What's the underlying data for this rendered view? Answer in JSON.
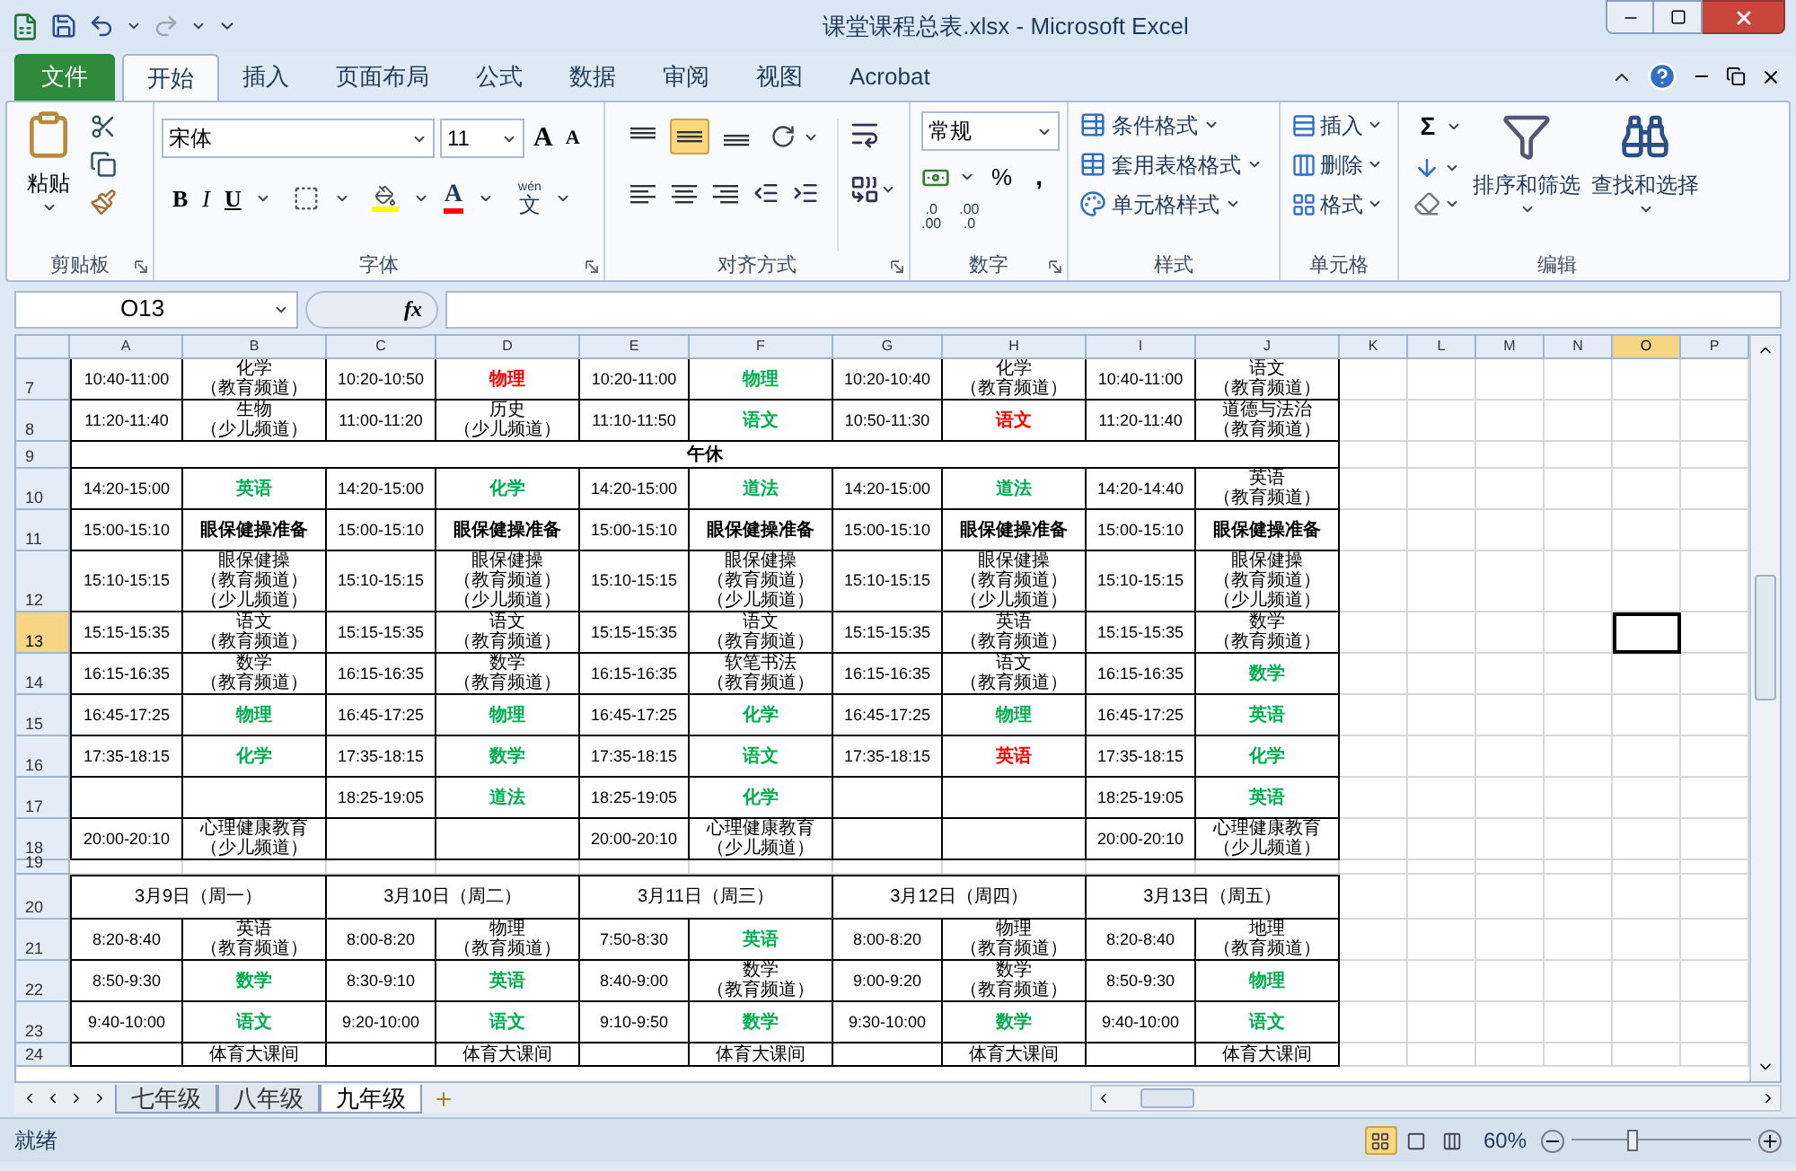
{
  "window": {
    "title": "课堂课程总表.xlsx - Microsoft Excel"
  },
  "ribbon_tabs": [
    {
      "label": "文件",
      "kind": "file",
      "selected": false
    },
    {
      "label": "开始",
      "kind": "tab",
      "selected": true
    },
    {
      "label": "插入",
      "kind": "tab",
      "selected": false
    },
    {
      "label": "页面布局",
      "kind": "tab",
      "selected": false
    },
    {
      "label": "公式",
      "kind": "tab",
      "selected": false
    },
    {
      "label": "数据",
      "kind": "tab",
      "selected": false
    },
    {
      "label": "审阅",
      "kind": "tab",
      "selected": false
    },
    {
      "label": "视图",
      "kind": "tab",
      "selected": false
    },
    {
      "label": "Acrobat",
      "kind": "tab",
      "selected": false
    }
  ],
  "clipboard": {
    "paste": "粘贴",
    "label": "剪贴板"
  },
  "font": {
    "label": "字体",
    "family": "宋体",
    "size": "11",
    "grow": "A",
    "shrink": "A",
    "bold": "B",
    "italic": "I",
    "underline": "U",
    "font_color": "A",
    "phonetic_top": "wén",
    "phonetic_bottom": "文"
  },
  "alignment": {
    "label": "对齐方式",
    "vertical_align": [
      {
        "selected": false
      },
      {
        "selected": true
      },
      {
        "selected": false
      }
    ]
  },
  "number": {
    "label": "数字",
    "format": "常规",
    "percent": "%",
    "comma": ",",
    "increase_decimal": [
      ".0",
      ".00"
    ],
    "decrease_decimal": [
      ".00",
      ".0"
    ]
  },
  "styles": {
    "label": "样式",
    "items": [
      "条件格式",
      "套用表格格式",
      "单元格样式"
    ]
  },
  "cells": {
    "label": "单元格",
    "items": [
      "插入",
      "删除",
      "格式"
    ]
  },
  "editing": {
    "label": "编辑",
    "sum": "Σ",
    "sort": "排序和筛选",
    "find": "查找和选择"
  },
  "formula_bar": {
    "name_box": "O13",
    "fx": "fx"
  },
  "columns": [
    {
      "label": "A",
      "selected": false
    },
    {
      "label": "B",
      "selected": false
    },
    {
      "label": "C",
      "selected": false
    },
    {
      "label": "D",
      "selected": false
    },
    {
      "label": "E",
      "selected": false
    },
    {
      "label": "F",
      "selected": false
    },
    {
      "label": "G",
      "selected": false
    },
    {
      "label": "H",
      "selected": false
    },
    {
      "label": "I",
      "selected": false
    },
    {
      "label": "J",
      "selected": false
    },
    {
      "label": "K",
      "selected": false
    },
    {
      "label": "L",
      "selected": false
    },
    {
      "label": "M",
      "selected": false
    },
    {
      "label": "N",
      "selected": false
    },
    {
      "label": "O",
      "selected": true
    },
    {
      "label": "P",
      "selected": false
    }
  ],
  "rows": [
    {
      "number": "7",
      "kind": "schedule",
      "selected": false,
      "cells": [
        {
          "kind": "time",
          "lines": [
            "10:40-11:00"
          ]
        },
        {
          "kind": "plain",
          "lines": [
            "化学",
            "（教育频道）"
          ]
        },
        {
          "kind": "time",
          "lines": [
            "10:20-10:50"
          ]
        },
        {
          "kind": "red",
          "lines": [
            "物理"
          ]
        },
        {
          "kind": "time",
          "lines": [
            "10:20-11:00"
          ]
        },
        {
          "kind": "green",
          "lines": [
            "物理"
          ]
        },
        {
          "kind": "time",
          "lines": [
            "10:20-10:40"
          ]
        },
        {
          "kind": "plain",
          "lines": [
            "化学",
            "（教育频道）"
          ]
        },
        {
          "kind": "time",
          "lines": [
            "10:40-11:00"
          ]
        },
        {
          "kind": "plain",
          "lines": [
            "语文",
            "（教育频道）"
          ]
        }
      ]
    },
    {
      "number": "8",
      "kind": "schedule",
      "selected": false,
      "cells": [
        {
          "kind": "time",
          "lines": [
            "11:20-11:40"
          ]
        },
        {
          "kind": "plain",
          "lines": [
            "生物",
            "（少儿频道）"
          ]
        },
        {
          "kind": "time",
          "lines": [
            "11:00-11:20"
          ]
        },
        {
          "kind": "plain",
          "lines": [
            "历史",
            "（少儿频道）"
          ]
        },
        {
          "kind": "time",
          "lines": [
            "11:10-11:50"
          ]
        },
        {
          "kind": "green",
          "lines": [
            "语文"
          ]
        },
        {
          "kind": "time",
          "lines": [
            "10:50-11:30"
          ]
        },
        {
          "kind": "red",
          "lines": [
            "语文"
          ]
        },
        {
          "kind": "time",
          "lines": [
            "11:20-11:40"
          ]
        },
        {
          "kind": "plain",
          "lines": [
            "道德与法治",
            "（教育频道）"
          ]
        }
      ]
    },
    {
      "number": "9",
      "kind": "merged",
      "selected": false,
      "cells": [
        {
          "kind": "bold",
          "lines": [
            "午休"
          ]
        }
      ]
    },
    {
      "number": "10",
      "kind": "schedule",
      "selected": false,
      "cells": [
        {
          "kind": "time",
          "lines": [
            "14:20-15:00"
          ]
        },
        {
          "kind": "green",
          "lines": [
            "英语"
          ]
        },
        {
          "kind": "time",
          "lines": [
            "14:20-15:00"
          ]
        },
        {
          "kind": "green",
          "lines": [
            "化学"
          ]
        },
        {
          "kind": "time",
          "lines": [
            "14:20-15:00"
          ]
        },
        {
          "kind": "green",
          "lines": [
            "道法"
          ]
        },
        {
          "kind": "time",
          "lines": [
            "14:20-15:00"
          ]
        },
        {
          "kind": "green",
          "lines": [
            "道法"
          ]
        },
        {
          "kind": "time",
          "lines": [
            "14:20-14:40"
          ]
        },
        {
          "kind": "plain",
          "lines": [
            "英语",
            "（教育频道）"
          ]
        }
      ]
    },
    {
      "number": "11",
      "kind": "schedule",
      "selected": false,
      "cells": [
        {
          "kind": "time",
          "lines": [
            "15:00-15:10"
          ]
        },
        {
          "kind": "bold",
          "lines": [
            "眼保健操准备"
          ]
        },
        {
          "kind": "time",
          "lines": [
            "15:00-15:10"
          ]
        },
        {
          "kind": "bold",
          "lines": [
            "眼保健操准备"
          ]
        },
        {
          "kind": "time",
          "lines": [
            "15:00-15:10"
          ]
        },
        {
          "kind": "bold",
          "lines": [
            "眼保健操准备"
          ]
        },
        {
          "kind": "time",
          "lines": [
            "15:00-15:10"
          ]
        },
        {
          "kind": "bold",
          "lines": [
            "眼保健操准备"
          ]
        },
        {
          "kind": "time",
          "lines": [
            "15:00-15:10"
          ]
        },
        {
          "kind": "bold",
          "lines": [
            "眼保健操准备"
          ]
        }
      ]
    },
    {
      "number": "12",
      "kind": "schedule",
      "selected": false,
      "cells": [
        {
          "kind": "time",
          "lines": [
            "15:10-15:15"
          ]
        },
        {
          "kind": "plain",
          "lines": [
            "眼保健操",
            "（教育频道）",
            "（少儿频道）"
          ]
        },
        {
          "kind": "time",
          "lines": [
            "15:10-15:15"
          ]
        },
        {
          "kind": "plain",
          "lines": [
            "眼保健操",
            "（教育频道）",
            "（少儿频道）"
          ]
        },
        {
          "kind": "time",
          "lines": [
            "15:10-15:15"
          ]
        },
        {
          "kind": "plain",
          "lines": [
            "眼保健操",
            "（教育频道）",
            "（少儿频道）"
          ]
        },
        {
          "kind": "time",
          "lines": [
            "15:10-15:15"
          ]
        },
        {
          "kind": "plain",
          "lines": [
            "眼保健操",
            "（教育频道）",
            "（少儿频道）"
          ]
        },
        {
          "kind": "time",
          "lines": [
            "15:10-15:15"
          ]
        },
        {
          "kind": "plain",
          "lines": [
            "眼保健操",
            "（教育频道）",
            "（少儿频道）"
          ]
        }
      ]
    },
    {
      "number": "13",
      "kind": "schedule",
      "selected": true,
      "cells": [
        {
          "kind": "time",
          "lines": [
            "15:15-15:35"
          ]
        },
        {
          "kind": "plain",
          "lines": [
            "语文",
            "（教育频道）"
          ]
        },
        {
          "kind": "time",
          "lines": [
            "15:15-15:35"
          ]
        },
        {
          "kind": "plain",
          "lines": [
            "语文",
            "（教育频道）"
          ]
        },
        {
          "kind": "time",
          "lines": [
            "15:15-15:35"
          ]
        },
        {
          "kind": "plain",
          "lines": [
            "语文",
            "（教育频道）"
          ]
        },
        {
          "kind": "time",
          "lines": [
            "15:15-15:35"
          ]
        },
        {
          "kind": "plain",
          "lines": [
            "英语",
            "（教育频道）"
          ]
        },
        {
          "kind": "time",
          "lines": [
            "15:15-15:35"
          ]
        },
        {
          "kind": "plain",
          "lines": [
            "数学",
            "（教育频道）"
          ]
        }
      ]
    },
    {
      "number": "14",
      "kind": "schedule",
      "selected": false,
      "cells": [
        {
          "kind": "time",
          "lines": [
            "16:15-16:35"
          ]
        },
        {
          "kind": "plain",
          "lines": [
            "数学",
            "（教育频道）"
          ]
        },
        {
          "kind": "time",
          "lines": [
            "16:15-16:35"
          ]
        },
        {
          "kind": "plain",
          "lines": [
            "数学",
            "（教育频道）"
          ]
        },
        {
          "kind": "time",
          "lines": [
            "16:15-16:35"
          ]
        },
        {
          "kind": "plain",
          "lines": [
            "软笔书法",
            "（教育频道）"
          ]
        },
        {
          "kind": "time",
          "lines": [
            "16:15-16:35"
          ]
        },
        {
          "kind": "plain",
          "lines": [
            "语文",
            "（教育频道）"
          ]
        },
        {
          "kind": "time",
          "lines": [
            "16:15-16:35"
          ]
        },
        {
          "kind": "green",
          "lines": [
            "数学"
          ]
        }
      ]
    },
    {
      "number": "15",
      "kind": "schedule",
      "selected": false,
      "cells": [
        {
          "kind": "time",
          "lines": [
            "16:45-17:25"
          ]
        },
        {
          "kind": "green",
          "lines": [
            "物理"
          ]
        },
        {
          "kind": "time",
          "lines": [
            "16:45-17:25"
          ]
        },
        {
          "kind": "green",
          "lines": [
            "物理"
          ]
        },
        {
          "kind": "time",
          "lines": [
            "16:45-17:25"
          ]
        },
        {
          "kind": "green",
          "lines": [
            "化学"
          ]
        },
        {
          "kind": "time",
          "lines": [
            "16:45-17:25"
          ]
        },
        {
          "kind": "green",
          "lines": [
            "物理"
          ]
        },
        {
          "kind": "time",
          "lines": [
            "16:45-17:25"
          ]
        },
        {
          "kind": "green",
          "lines": [
            "英语"
          ]
        }
      ]
    },
    {
      "number": "16",
      "kind": "schedule",
      "selected": false,
      "cells": [
        {
          "kind": "time",
          "lines": [
            "17:35-18:15"
          ]
        },
        {
          "kind": "green",
          "lines": [
            "化学"
          ]
        },
        {
          "kind": "time",
          "lines": [
            "17:35-18:15"
          ]
        },
        {
          "kind": "green",
          "lines": [
            "数学"
          ]
        },
        {
          "kind": "time",
          "lines": [
            "17:35-18:15"
          ]
        },
        {
          "kind": "green",
          "lines": [
            "语文"
          ]
        },
        {
          "kind": "time",
          "lines": [
            "17:35-18:15"
          ]
        },
        {
          "kind": "red",
          "lines": [
            "英语"
          ]
        },
        {
          "kind": "time",
          "lines": [
            "17:35-18:15"
          ]
        },
        {
          "kind": "green",
          "lines": [
            "化学"
          ]
        }
      ]
    },
    {
      "number": "17",
      "kind": "schedule",
      "selected": false,
      "cells": [
        null,
        null,
        {
          "kind": "time",
          "lines": [
            "18:25-19:05"
          ]
        },
        {
          "kind": "green",
          "lines": [
            "道法"
          ]
        },
        {
          "kind": "time",
          "lines": [
            "18:25-19:05"
          ]
        },
        {
          "kind": "green",
          "lines": [
            "化学"
          ]
        },
        null,
        null,
        {
          "kind": "time",
          "lines": [
            "18:25-19:05"
          ]
        },
        {
          "kind": "green",
          "lines": [
            "英语"
          ]
        }
      ]
    },
    {
      "number": "18",
      "kind": "schedule",
      "selected": false,
      "cells": [
        {
          "kind": "time",
          "lines": [
            "20:00-20:10"
          ]
        },
        {
          "kind": "plain",
          "lines": [
            "心理健康教育",
            "（少儿频道）"
          ]
        },
        null,
        null,
        {
          "kind": "time",
          "lines": [
            "20:00-20:10"
          ]
        },
        {
          "kind": "plain",
          "lines": [
            "心理健康教育",
            "（少儿频道）"
          ]
        },
        null,
        null,
        {
          "kind": "time",
          "lines": [
            "20:00-20:10"
          ]
        },
        {
          "kind": "plain",
          "lines": [
            "心理健康教育",
            "（少儿频道）"
          ]
        }
      ]
    },
    {
      "number": "19",
      "kind": "blank",
      "selected": false,
      "cells": []
    },
    {
      "number": "20",
      "kind": "dates",
      "selected": false,
      "cells": [
        {
          "kind": "plain",
          "lines": [
            "3月9日（周一）"
          ]
        },
        {
          "kind": "plain",
          "lines": [
            "3月10日（周二）"
          ]
        },
        {
          "kind": "plain",
          "lines": [
            "3月11日（周三）"
          ]
        },
        {
          "kind": "plain",
          "lines": [
            "3月12日（周四）"
          ]
        },
        {
          "kind": "plain",
          "lines": [
            "3月13日（周五）"
          ]
        }
      ]
    },
    {
      "number": "21",
      "kind": "schedule",
      "selected": false,
      "cells": [
        {
          "kind": "time",
          "lines": [
            "8:20-8:40"
          ]
        },
        {
          "kind": "plain",
          "lines": [
            "英语",
            "（教育频道）"
          ]
        },
        {
          "kind": "time",
          "lines": [
            "8:00-8:20"
          ]
        },
        {
          "kind": "plain",
          "lines": [
            "物理",
            "（教育频道）"
          ]
        },
        {
          "kind": "time",
          "lines": [
            "7:50-8:30"
          ]
        },
        {
          "kind": "green",
          "lines": [
            "英语"
          ]
        },
        {
          "kind": "time",
          "lines": [
            "8:00-8:20"
          ]
        },
        {
          "kind": "plain",
          "lines": [
            "物理",
            "（教育频道）"
          ]
        },
        {
          "kind": "time",
          "lines": [
            "8:20-8:40"
          ]
        },
        {
          "kind": "plain",
          "lines": [
            "地理",
            "（教育频道）"
          ]
        }
      ]
    },
    {
      "number": "22",
      "kind": "schedule",
      "selected": false,
      "cells": [
        {
          "kind": "time",
          "lines": [
            "8:50-9:30"
          ]
        },
        {
          "kind": "green",
          "lines": [
            "数学"
          ]
        },
        {
          "kind": "time",
          "lines": [
            "8:30-9:10"
          ]
        },
        {
          "kind": "green",
          "lines": [
            "英语"
          ]
        },
        {
          "kind": "time",
          "lines": [
            "8:40-9:00"
          ]
        },
        {
          "kind": "plain",
          "lines": [
            "数学",
            "（教育频道）"
          ]
        },
        {
          "kind": "time",
          "lines": [
            "9:00-9:20"
          ]
        },
        {
          "kind": "plain",
          "lines": [
            "数学",
            "（教育频道）"
          ]
        },
        {
          "kind": "time",
          "lines": [
            "8:50-9:30"
          ]
        },
        {
          "kind": "green",
          "lines": [
            "物理"
          ]
        }
      ]
    },
    {
      "number": "23",
      "kind": "schedule",
      "selected": false,
      "cells": [
        {
          "kind": "time",
          "lines": [
            "9:40-10:00"
          ]
        },
        {
          "kind": "green",
          "lines": [
            "语文"
          ]
        },
        {
          "kind": "time",
          "lines": [
            "9:20-10:00"
          ]
        },
        {
          "kind": "green",
          "lines": [
            "语文"
          ]
        },
        {
          "kind": "time",
          "lines": [
            "9:10-9:50"
          ]
        },
        {
          "kind": "green",
          "lines": [
            "数学"
          ]
        },
        {
          "kind": "time",
          "lines": [
            "9:30-10:00"
          ]
        },
        {
          "kind": "green",
          "lines": [
            "数学"
          ]
        },
        {
          "kind": "time",
          "lines": [
            "9:40-10:00"
          ]
        },
        {
          "kind": "green",
          "lines": [
            "语文"
          ]
        }
      ]
    },
    {
      "number": "24",
      "kind": "partial",
      "selected": false,
      "cells": [
        null,
        {
          "kind": "plain",
          "lines": [
            "体育大课间"
          ]
        },
        null,
        {
          "kind": "plain",
          "lines": [
            "体育大课间"
          ]
        },
        null,
        {
          "kind": "plain",
          "lines": [
            "体育大课间"
          ]
        },
        null,
        {
          "kind": "plain",
          "lines": [
            "体育大课间"
          ]
        },
        null,
        {
          "kind": "plain",
          "lines": [
            "体育大课间"
          ]
        }
      ]
    }
  ],
  "sheet_tabs": [
    {
      "label": "七年级",
      "selected": false
    },
    {
      "label": "八年级",
      "selected": false
    },
    {
      "label": "九年级",
      "selected": true
    }
  ],
  "status_bar": {
    "status": "就绪",
    "view_buttons": [
      {
        "selected": true
      },
      {
        "selected": false
      },
      {
        "selected": false
      }
    ],
    "zoom": "60%",
    "zoom_slider": {
      "level": 0.34
    }
  }
}
